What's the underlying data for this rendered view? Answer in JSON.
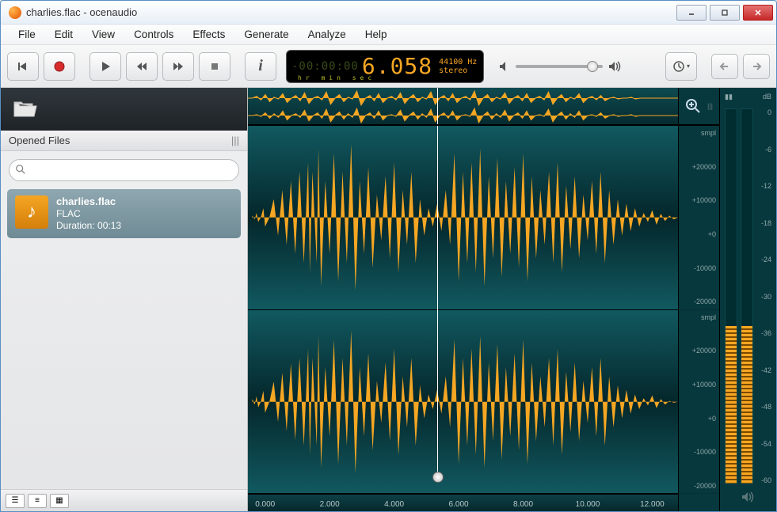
{
  "window": {
    "title": "charlies.flac - ocenaudio"
  },
  "menu": {
    "file": "File",
    "edit": "Edit",
    "view": "View",
    "controls": "Controls",
    "effects": "Effects",
    "generate": "Generate",
    "analyze": "Analyze",
    "help": "Help"
  },
  "timecode": {
    "neg": "-00:00:00",
    "cur": "6.058",
    "hz": "44100 Hz",
    "mode": "stereo",
    "labels": "hr   min  sec"
  },
  "sidebar": {
    "section": "Opened Files",
    "search_placeholder": "",
    "file": {
      "name": "charlies.flac",
      "format": "FLAC",
      "duration": "Duration: 00:13"
    }
  },
  "ruler": {
    "ticks": [
      "0.000",
      "2.000",
      "4.000",
      "6.000",
      "8.000",
      "10.000",
      "12.000"
    ]
  },
  "ampscale": {
    "label": "smpl",
    "vals": [
      "+20000",
      "+10000",
      "+0",
      "-10000",
      "-20000"
    ]
  },
  "meters": {
    "label": "dB",
    "vals": [
      "0",
      "-6",
      "-12",
      "-18",
      "-24",
      "-30",
      "-36",
      "-42",
      "-48",
      "-54",
      "-60"
    ]
  }
}
